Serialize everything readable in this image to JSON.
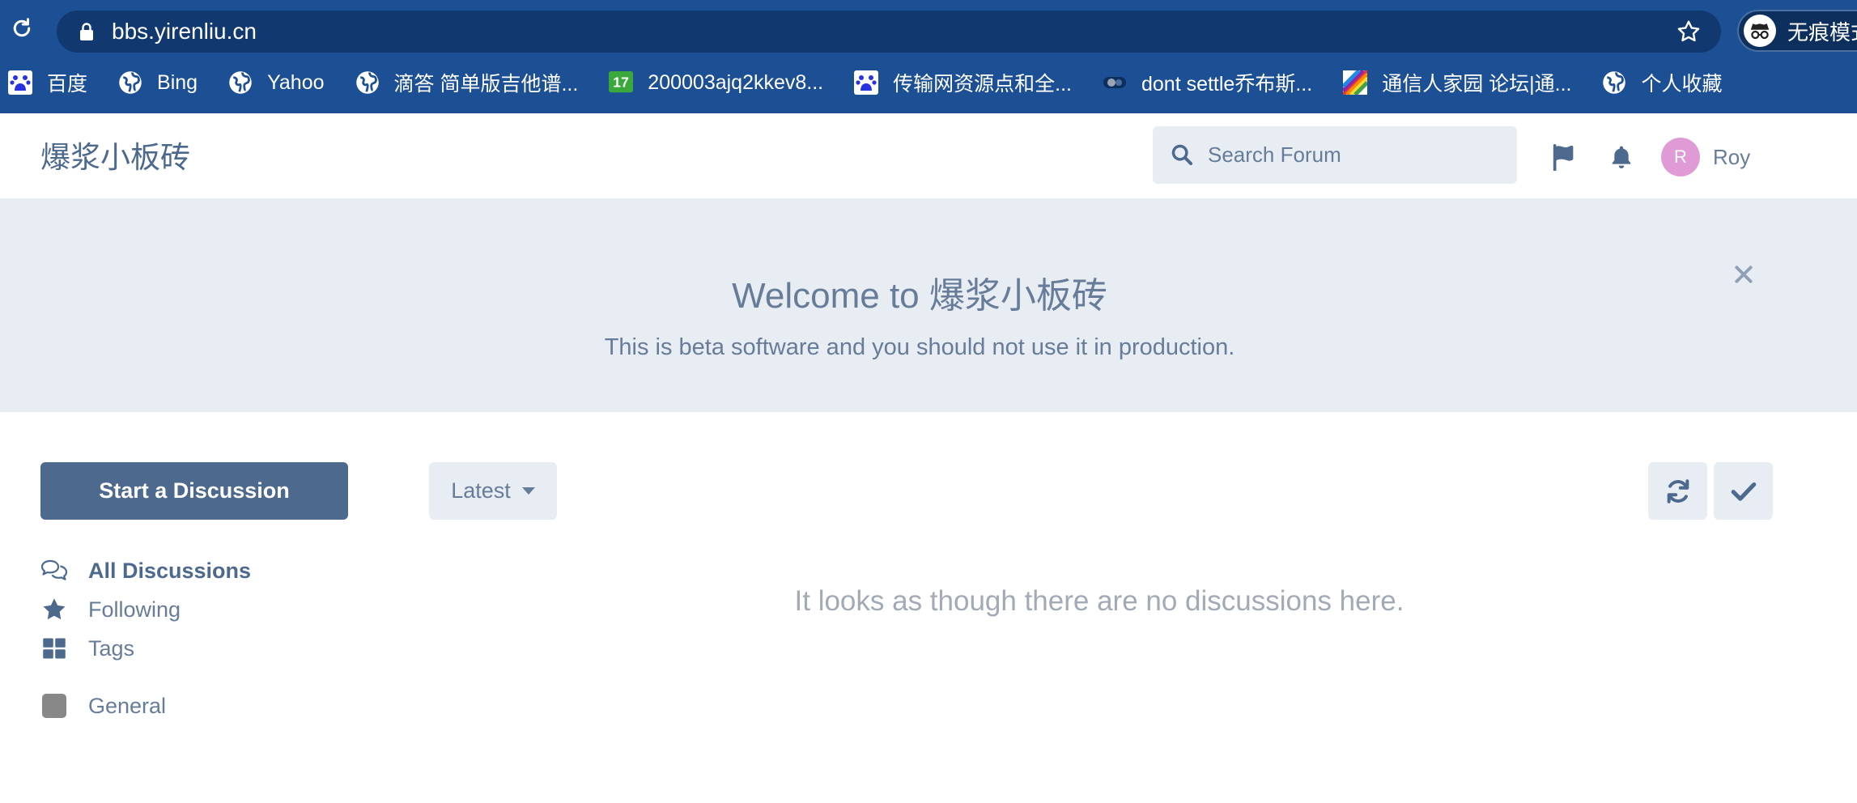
{
  "browser": {
    "url": "bbs.yirenliu.cn",
    "incognito_label": "无痕模式",
    "bookmarks": [
      {
        "label": "百度",
        "icon": "baidu-icon"
      },
      {
        "label": "Bing",
        "icon": "globe-icon"
      },
      {
        "label": "Yahoo",
        "icon": "globe-icon"
      },
      {
        "label": "滴答 简单版吉他谱...",
        "icon": "globe-icon"
      },
      {
        "label": "200003ajq2kkev8...",
        "icon": "seventeen-icon"
      },
      {
        "label": "传输网资源点和全...",
        "icon": "baidu-icon"
      },
      {
        "label": "dont settle乔布斯...",
        "icon": "toggle-icon"
      },
      {
        "label": "通信人家园 论坛|通...",
        "icon": "rainbow-icon"
      },
      {
        "label": "个人收藏",
        "icon": "globe-icon"
      }
    ]
  },
  "header": {
    "site_title": "爆浆小板砖",
    "search_placeholder": "Search Forum",
    "avatar_initial": "R",
    "user_name": "Roy"
  },
  "hero": {
    "title": "Welcome to 爆浆小板砖",
    "description": "This is beta software and you should not use it in production."
  },
  "toolbar": {
    "start_label": "Start a Discussion",
    "sort_label": "Latest"
  },
  "nav": {
    "items": [
      {
        "label": "All Discussions",
        "icon": "comments-icon",
        "active": true
      },
      {
        "label": "Following",
        "icon": "star-icon"
      },
      {
        "label": "Tags",
        "icon": "grid-icon"
      },
      {
        "label": "General",
        "icon": "tag-square-icon"
      }
    ]
  },
  "main": {
    "empty_message": "It looks as though there are no discussions here."
  },
  "colors": {
    "browser_frame": "#1c4f94",
    "primary": "#4d698e",
    "muted": "#667c99",
    "hero_bg": "#e8ecf3",
    "button_bg": "#e7edf3",
    "avatar": "#e09ad6",
    "tag_general": "#888888"
  }
}
